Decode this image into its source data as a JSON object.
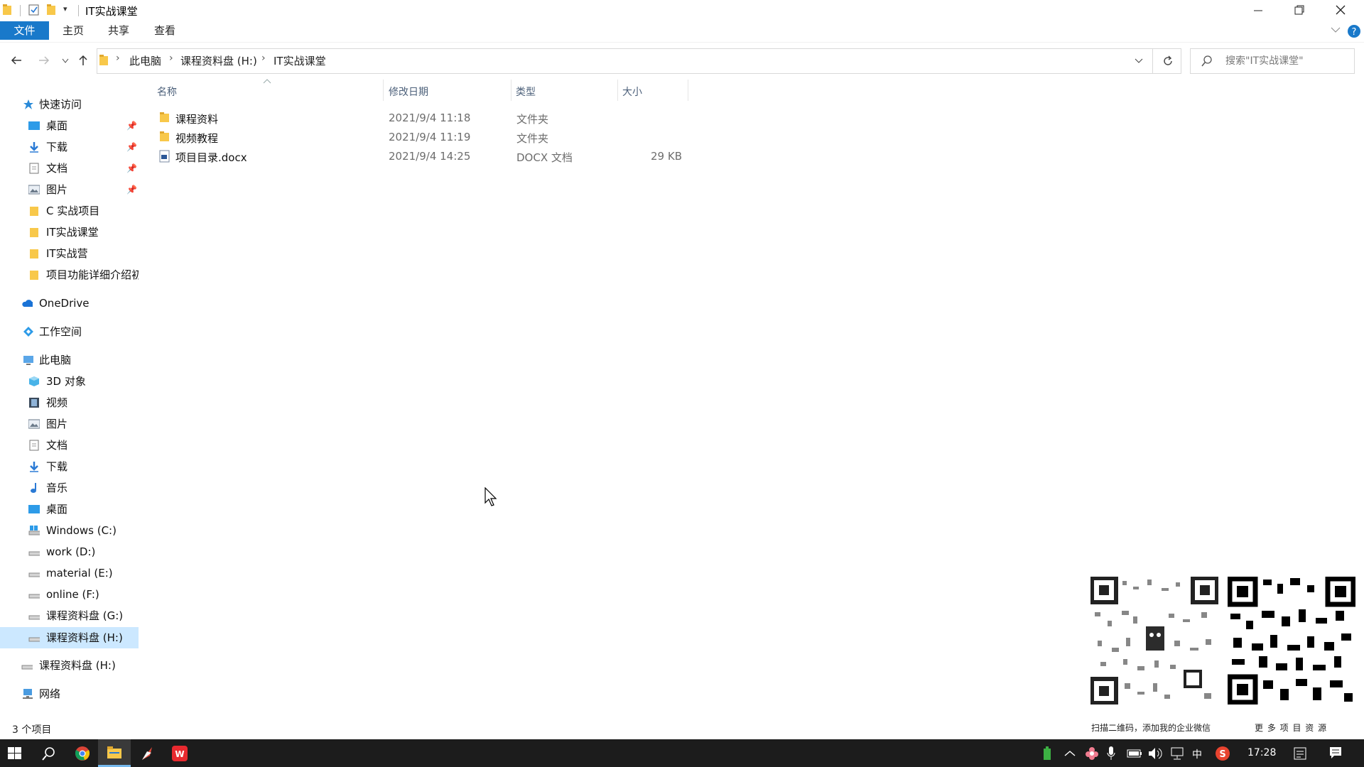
{
  "window": {
    "title": "IT实战课堂",
    "quick_access_toolbar_arrow": "▾"
  },
  "ribbon": {
    "file_tab": "文件",
    "tabs": [
      "主页",
      "共享",
      "查看"
    ]
  },
  "address": {
    "crumbs": [
      "此电脑",
      "课程资料盘 (H:)",
      "IT实战课堂"
    ],
    "search_placeholder": "搜索\"IT实战课堂\""
  },
  "nav": {
    "quick_access": "快速访问",
    "quick_items": [
      {
        "label": "桌面",
        "icon": "desktop-icon",
        "pinned": true
      },
      {
        "label": "下载",
        "icon": "download-icon",
        "pinned": true
      },
      {
        "label": "文档",
        "icon": "document-icon",
        "pinned": true
      },
      {
        "label": "图片",
        "icon": "picture-icon",
        "pinned": true
      },
      {
        "label": "C 实战项目",
        "icon": "folder-icon",
        "pinned": false
      },
      {
        "label": "IT实战课堂",
        "icon": "folder-icon",
        "pinned": false
      },
      {
        "label": "IT实战营",
        "icon": "folder-icon",
        "pinned": false
      },
      {
        "label": "项目功能详细介绍初",
        "icon": "folder-icon",
        "pinned": false
      }
    ],
    "onedrive": "OneDrive",
    "workspace": "工作空间",
    "this_pc": "此电脑",
    "pc_items": [
      {
        "label": "3D 对象",
        "icon": "3d-objects-icon"
      },
      {
        "label": "视频",
        "icon": "video-icon"
      },
      {
        "label": "图片",
        "icon": "picture-icon"
      },
      {
        "label": "文档",
        "icon": "document-icon"
      },
      {
        "label": "下载",
        "icon": "download-icon"
      },
      {
        "label": "音乐",
        "icon": "music-icon"
      },
      {
        "label": "桌面",
        "icon": "desktop-icon"
      },
      {
        "label": "Windows (C:)",
        "icon": "windows-drive-icon"
      },
      {
        "label": "work (D:)",
        "icon": "drive-icon"
      },
      {
        "label": "material (E:)",
        "icon": "drive-icon"
      },
      {
        "label": "online (F:)",
        "icon": "drive-icon"
      },
      {
        "label": "课程资料盘 (G:)",
        "icon": "drive-icon"
      },
      {
        "label": "课程资料盘 (H:)",
        "icon": "drive-icon"
      }
    ],
    "extra_drive": "课程资料盘 (H:)",
    "network": "网络"
  },
  "columns": {
    "name": "名称",
    "date": "修改日期",
    "type": "类型",
    "size": "大小"
  },
  "files": [
    {
      "name": "课程资料",
      "date": "2021/9/4 11:18",
      "type": "文件夹",
      "size": "",
      "icon": "folder-icon"
    },
    {
      "name": "视频教程",
      "date": "2021/9/4 11:19",
      "type": "文件夹",
      "size": "",
      "icon": "folder-icon"
    },
    {
      "name": "项目目录.docx",
      "date": "2021/9/4 14:25",
      "type": "DOCX 文档",
      "size": "29 KB",
      "icon": "docx-icon"
    }
  ],
  "status": {
    "item_count": "3 个项目"
  },
  "overlay": {
    "caption_left": "扫描二维码，添加我的企业微信",
    "caption_right": "更 多 项 目 资 源"
  },
  "taskbar": {
    "ime": "中",
    "time": "17:28"
  },
  "colors": {
    "accent": "#1979ca",
    "selection": "#cce8ff",
    "folder": "#f8c84a",
    "taskbar": "#1c1c1c"
  }
}
